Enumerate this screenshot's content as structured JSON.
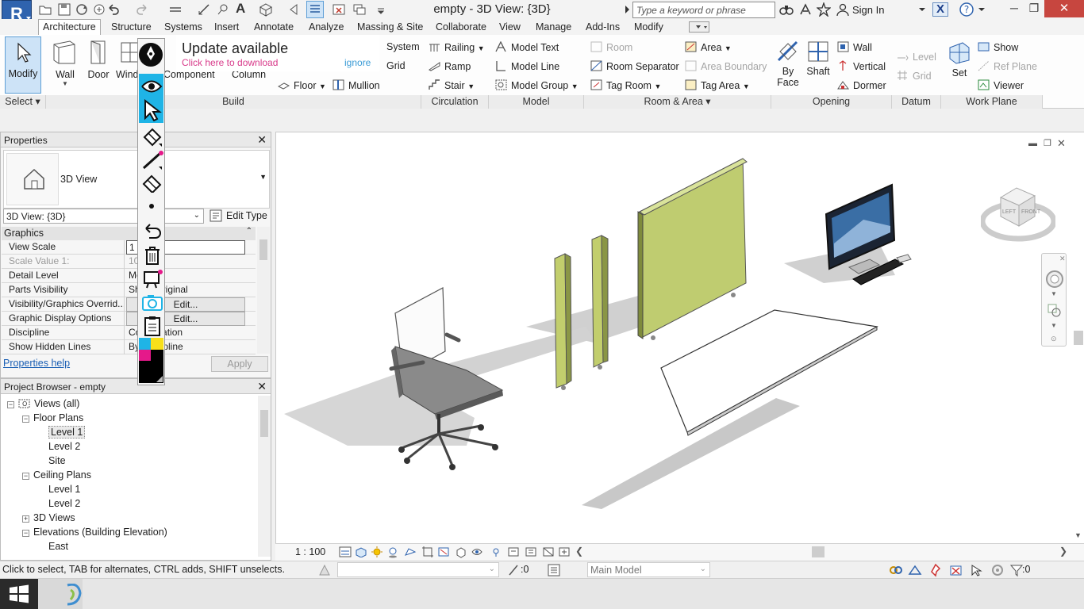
{
  "app": {
    "logo_letter": "R",
    "title": "empty - 3D View: {3D}",
    "search_placeholder": "Type a keyword or phrase",
    "sign_in": "Sign In"
  },
  "tabs": [
    "Architecture",
    "Structure",
    "Systems",
    "Insert",
    "Annotate",
    "Analyze",
    "Massing & Site",
    "Collaborate",
    "View",
    "Manage",
    "Add-Ins",
    "Modify"
  ],
  "ribbon": {
    "modify_label": "Modify",
    "select_label": "Select",
    "build": {
      "wall": "Wall",
      "door": "Door",
      "window": "Window",
      "component": "Component",
      "column": "Column",
      "system": "System",
      "grid": "Grid",
      "floor": "Floor",
      "mullion": "Mullion",
      "panel_title": "Build"
    },
    "circulation": {
      "railing": "Railing",
      "ramp": "Ramp",
      "stair": "Stair",
      "panel_title": "Circulation"
    },
    "model": {
      "model_text": "Model  Text",
      "model_line": "Model  Line",
      "model_group": "Model  Group",
      "panel_title": "Model"
    },
    "room_area": {
      "room": "Room",
      "room_separator": "Room  Separator",
      "tag_room": "Tag  Room",
      "area": "Area",
      "area_boundary": "Area  Boundary",
      "tag_area": "Tag  Area",
      "panel_title": "Room & Area"
    },
    "opening": {
      "by_face_1": "By",
      "by_face_2": "Face",
      "shaft": "Shaft",
      "wall": "Wall",
      "vertical": "Vertical",
      "dormer": "Dormer",
      "panel_title": "Opening"
    },
    "datum": {
      "level": "Level",
      "grid": "Grid",
      "panel_title": "Datum"
    },
    "work_plane": {
      "set": "Set",
      "show": "Show",
      "ref_plane": "Ref  Plane",
      "viewer": "Viewer",
      "panel_title": "Work Plane"
    }
  },
  "update_notice": {
    "title": "Update available",
    "link": "Click here to download",
    "ignore": "ignore"
  },
  "properties": {
    "title": "Properties",
    "type_name": "3D View",
    "instance_selector": "3D View: {3D}",
    "edit_type": "Edit Type",
    "group": "Graphics",
    "rows": [
      {
        "name": "View Scale",
        "value": "1",
        "disabled": false
      },
      {
        "name": "Scale Value    1:",
        "value": "10",
        "disabled": true
      },
      {
        "name": "Detail Level",
        "value": "Medium",
        "disabled": false
      },
      {
        "name": "Parts Visibility",
        "value": "Show Original",
        "disabled": false
      },
      {
        "name": "Visibility/Graphics Overrid...",
        "value": "Edit...",
        "disabled": false
      },
      {
        "name": "Graphic Display Options",
        "value": "Edit...",
        "disabled": false
      },
      {
        "name": "Discipline",
        "value": "Coordination",
        "disabled": false
      },
      {
        "name": "Show Hidden Lines",
        "value": "By Discipline",
        "disabled": false
      }
    ],
    "help": "Properties help",
    "apply": "Apply"
  },
  "browser": {
    "title": "Project Browser - empty",
    "items": [
      {
        "label": "Views (all)",
        "depth": 0,
        "toggle": "−"
      },
      {
        "label": "Floor Plans",
        "depth": 1,
        "toggle": "−"
      },
      {
        "label": "Level 1",
        "depth": 2,
        "toggle": "",
        "selected": true
      },
      {
        "label": "Level 2",
        "depth": 2,
        "toggle": ""
      },
      {
        "label": "Site",
        "depth": 2,
        "toggle": ""
      },
      {
        "label": "Ceiling Plans",
        "depth": 1,
        "toggle": "−"
      },
      {
        "label": "Level 1",
        "depth": 2,
        "toggle": ""
      },
      {
        "label": "Level 2",
        "depth": 2,
        "toggle": ""
      },
      {
        "label": "3D Views",
        "depth": 1,
        "toggle": "+"
      },
      {
        "label": "Elevations (Building Elevation)",
        "depth": 1,
        "toggle": "−"
      },
      {
        "label": "East",
        "depth": 2,
        "toggle": ""
      }
    ]
  },
  "viewport": {
    "scale": "1 : 100",
    "cube_left": "LEFT",
    "cube_front": "FRONT"
  },
  "status": {
    "message": "Click to select, TAB for alternates, CTRL adds, SHIFT unselects.",
    "select_count": ":0",
    "model": "Main Model",
    "filter_count": ":0"
  },
  "colors": {
    "accent": "#2f63ae",
    "modify_bg": "#cde3f7",
    "pen_cyan": "#1fb4e6",
    "pen_magenta": "#e5198a",
    "pen_yellow": "#f7e01b"
  }
}
